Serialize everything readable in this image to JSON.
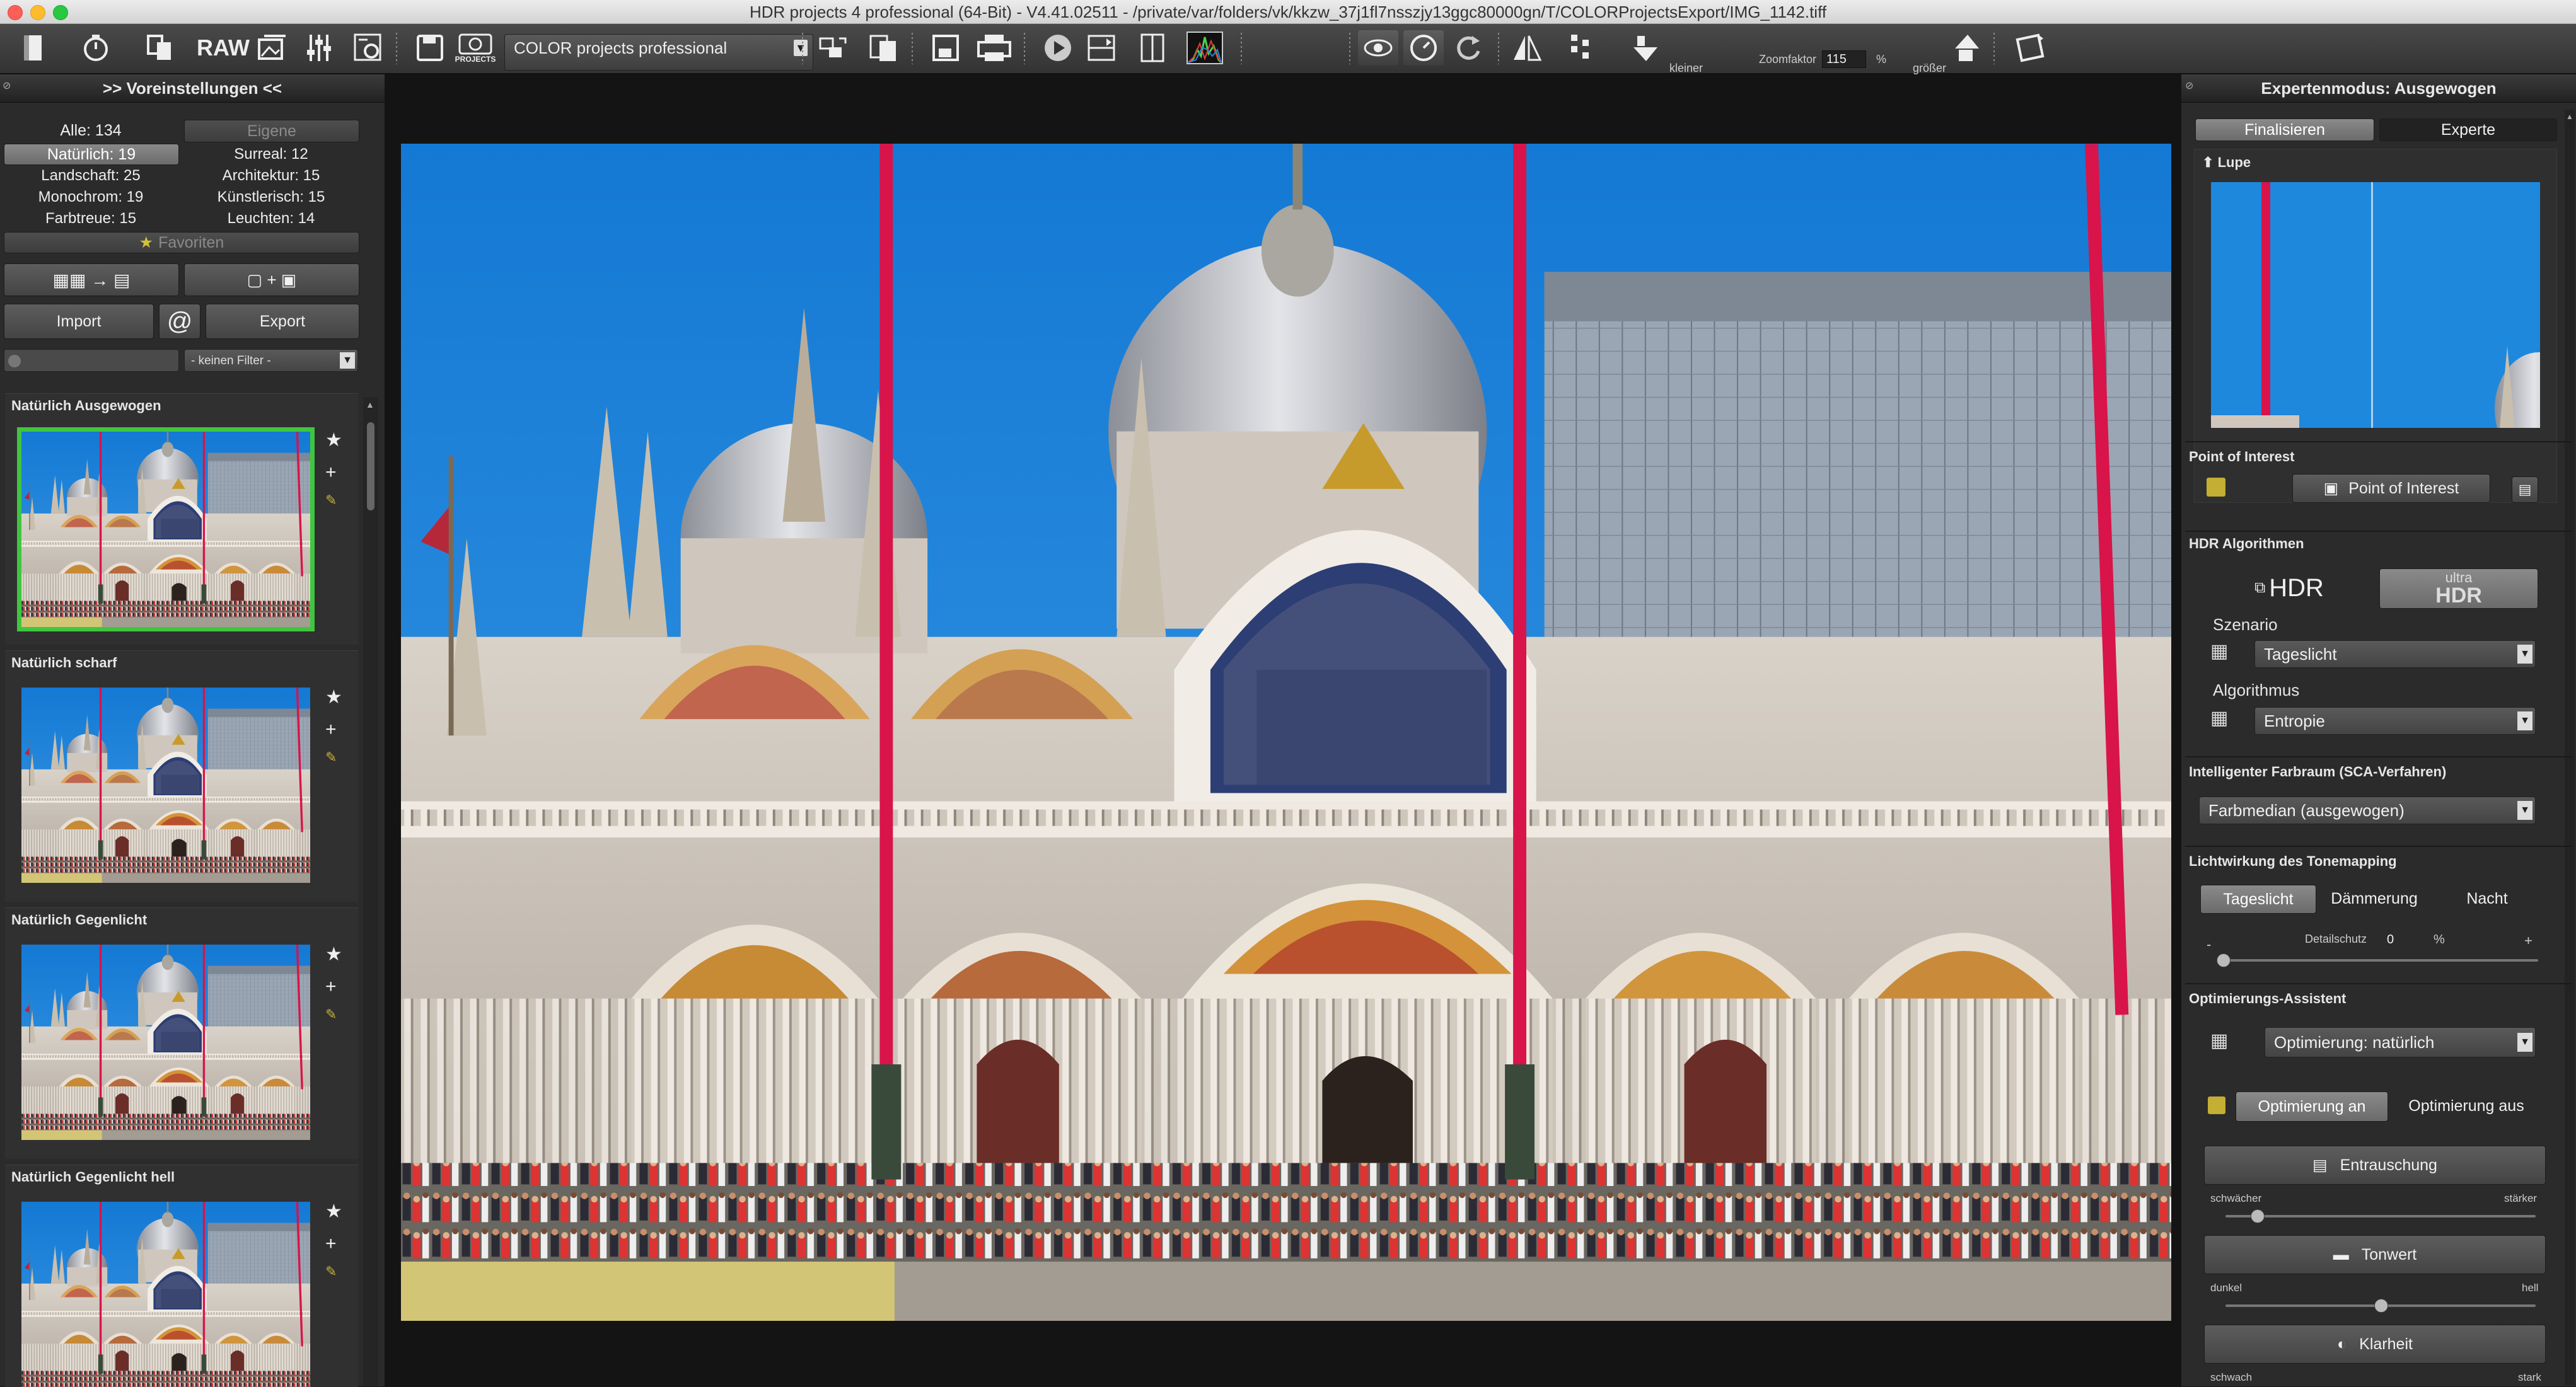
{
  "window": {
    "title": "HDR projects 4 professional (64-Bit) - V4.41.02511 - /private/var/folders/vk/kkzw_37j1fl7nsszjy13ggc80000gn/T/COLORProjectsExport/IMG_1142.tiff"
  },
  "toolbar": {
    "raw_label": "RAW",
    "projects_label": "PROJECTS",
    "preset_combo": "COLOR projects professional",
    "zoom_small_label": "kleiner",
    "zoom_factor_label": "Zoomfaktor",
    "zoom_value": "115",
    "zoom_unit": "%",
    "zoom_large_label": "größer"
  },
  "left": {
    "header": ">> Voreinstellungen <<",
    "categories": [
      {
        "label": "Alle: 134"
      },
      {
        "label": "Eigene"
      },
      {
        "label": "Natürlich: 19"
      },
      {
        "label": "Surreal: 12"
      },
      {
        "label": "Landschaft: 25"
      },
      {
        "label": "Architektur: 15"
      },
      {
        "label": "Monochrom: 19"
      },
      {
        "label": "Künstlerisch: 15"
      },
      {
        "label": "Farbtreue: 15"
      },
      {
        "label": "Leuchten: 14"
      }
    ],
    "favorites_label": "Favoriten",
    "import_label": "Import",
    "at_label": "@",
    "export_label": "Export",
    "filter_value": "- keinen Filter -",
    "presets": [
      {
        "name": "Natürlich Ausgewogen"
      },
      {
        "name": "Natürlich scharf"
      },
      {
        "name": "Natürlich Gegenlicht"
      },
      {
        "name": "Natürlich Gegenlicht hell"
      }
    ]
  },
  "right": {
    "header": "Expertenmodus: Ausgewogen",
    "tabs": [
      {
        "label": "Finalisieren"
      },
      {
        "label": "Experte"
      }
    ],
    "lupe_label": "Lupe",
    "poi_section": "Point of Interest",
    "poi_button": "Point of Interest",
    "hdr_section": "HDR Algorithmen",
    "hdr_label": "HDR",
    "ultra_label": "ultra",
    "ultra_hdr_label": "HDR",
    "szenario_label": "Szenario",
    "szenario_value": "Tageslicht",
    "algorithmus_label": "Algorithmus",
    "algorithmus_value": "Entropie",
    "farbraum_section": "Intelligenter Farbraum (SCA-Verfahren)",
    "farbraum_value": "Farbmedian (ausgewogen)",
    "licht_section": "Lichtwirkung des Tonemapping",
    "licht_buttons": [
      {
        "label": "Tageslicht"
      },
      {
        "label": "Dämmerung"
      },
      {
        "label": "Nacht"
      }
    ],
    "detailschutz_label": "Detailschutz",
    "detailschutz_value": "0",
    "detailschutz_unit": "%",
    "detailschutz_minus": "-",
    "detailschutz_plus": "+",
    "opt_section": "Optimierungs-Assistent",
    "opt_value": "Optimierung: natürlich",
    "opt_on": "Optimierung an",
    "opt_off": "Optimierung aus",
    "entrauschung_label": "Entrauschung",
    "entrauschung_min": "schwächer",
    "entrauschung_max": "stärker",
    "tonwert_label": "Tonwert",
    "tonwert_min": "dunkel",
    "tonwert_max": "hell",
    "klarheit_label": "Klarheit",
    "klarheit_min": "schwach",
    "klarheit_max": "stark"
  },
  "colors": {
    "sky": "#1f86d9",
    "active_outline": "#3fc63f",
    "pole": "#d8144a",
    "panel": "#2b2b2b"
  }
}
